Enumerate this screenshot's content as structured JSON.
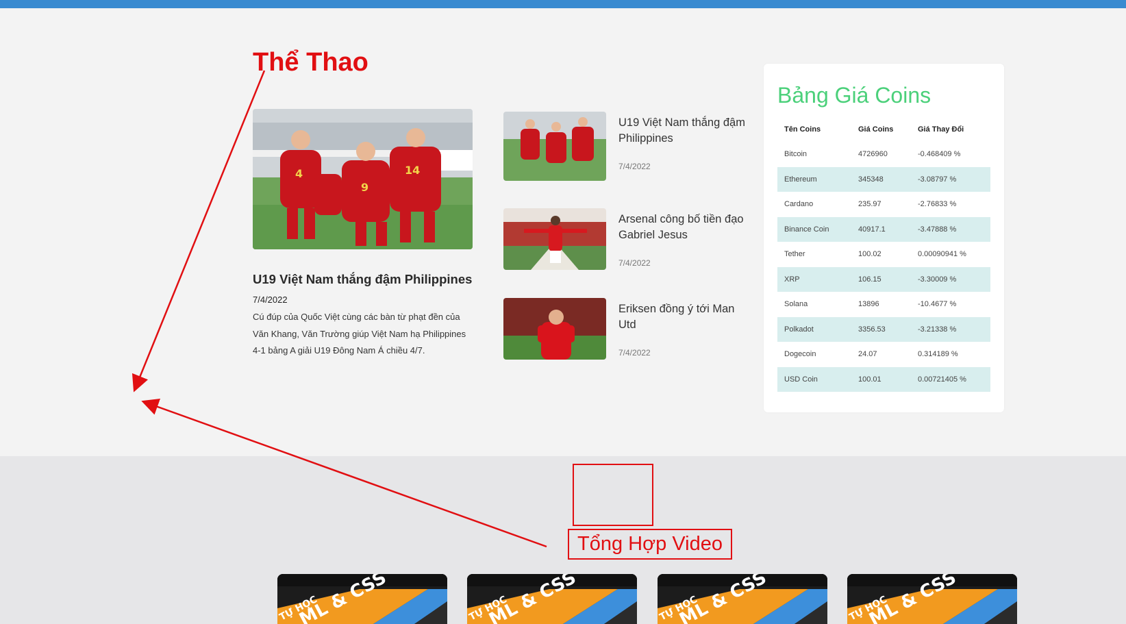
{
  "sports": {
    "title": "Thể Thao",
    "featured": {
      "title": "U19 Việt Nam thắng đậm Philippines",
      "date": "7/4/2022",
      "description": "Cú đúp của Quốc Việt cùng các bàn từ phạt đền của Văn Khang, Văn Trường giúp Việt Nam hạ Philippines 4-1 bảng A giải U19 Đông Nam Á chiều 4/7."
    },
    "side_items": [
      {
        "title": "U19 Việt Nam thắng đậm Philippines",
        "date": "7/4/2022"
      },
      {
        "title": "Arsenal công bố tiền đạo Gabriel Jesus",
        "date": "7/4/2022"
      },
      {
        "title": "Eriksen đồng ý tới Man Utd",
        "date": "7/4/2022"
      }
    ]
  },
  "coins": {
    "title": "Bảng Giá Coins",
    "headers": [
      "Tên Coins",
      "Giá Coins",
      "Giá Thay Đổi"
    ],
    "rows": [
      {
        "name": "Bitcoin",
        "price": "4726960",
        "change": "-0.468409 %"
      },
      {
        "name": "Ethereum",
        "price": "345348",
        "change": "-3.08797 %"
      },
      {
        "name": "Cardano",
        "price": "235.97",
        "change": "-2.76833 %"
      },
      {
        "name": "Binance Coin",
        "price": "40917.1",
        "change": "-3.47888 %"
      },
      {
        "name": "Tether",
        "price": "100.02",
        "change": "0.00090941 %"
      },
      {
        "name": "XRP",
        "price": "106.15",
        "change": "-3.30009 %"
      },
      {
        "name": "Solana",
        "price": "13896",
        "change": "-10.4677 %"
      },
      {
        "name": "Polkadot",
        "price": "3356.53",
        "change": "-3.21338 %"
      },
      {
        "name": "Dogecoin",
        "price": "24.07",
        "change": "0.314189 %"
      },
      {
        "name": "USD Coin",
        "price": "100.01",
        "change": "0.00721405 %"
      }
    ]
  },
  "video": {
    "title": "Tổng Hợp Video",
    "thumb_label_small": "TỰ HỌC",
    "thumb_label_big": "ML & CSS"
  },
  "colors": {
    "topbar": "#3b8bd0",
    "sports_title": "#e10f12",
    "coin_title": "#4bd07a",
    "table_alt_row": "#d8eeee",
    "annotation": "#e10f12"
  }
}
